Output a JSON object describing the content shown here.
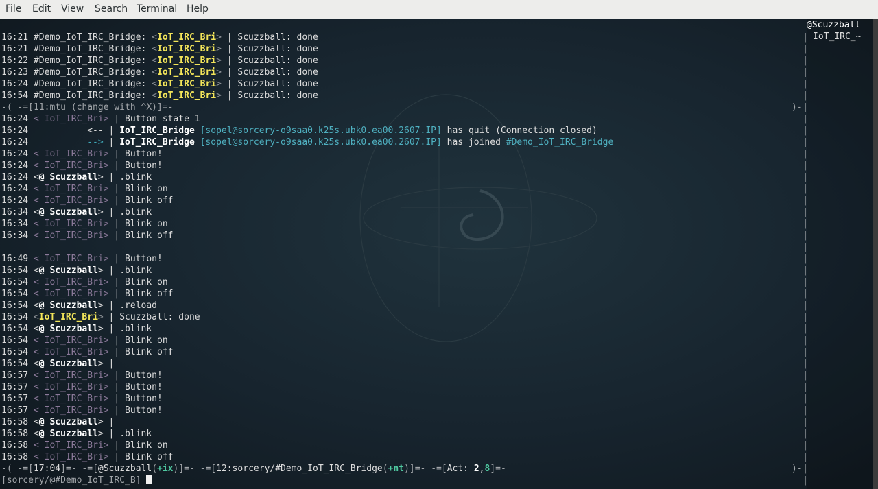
{
  "menubar": {
    "items": [
      "File",
      "Edit",
      "View",
      "Search",
      "Terminal",
      "Help"
    ]
  },
  "chat": {
    "top_lines": [
      {
        "time": "16:21",
        "chan": "#Demo_IoT_IRC_Bridge:",
        "nick": "IoT_IRC_Bri",
        "msg": "Scuzzball: done"
      },
      {
        "time": "16:21",
        "chan": "#Demo_IoT_IRC_Bridge:",
        "nick": "IoT_IRC_Bri",
        "msg": "Scuzzball: done"
      },
      {
        "time": "16:22",
        "chan": "#Demo_IoT_IRC_Bridge:",
        "nick": "IoT_IRC_Bri",
        "msg": "Scuzzball: done"
      },
      {
        "time": "16:23",
        "chan": "#Demo_IoT_IRC_Bridge:",
        "nick": "IoT_IRC_Bri",
        "msg": "Scuzzball: done"
      },
      {
        "time": "16:24",
        "chan": "#Demo_IoT_IRC_Bridge:",
        "nick": "IoT_IRC_Bri",
        "msg": "Scuzzball: done"
      },
      {
        "time": "16:54",
        "chan": "#Demo_IoT_IRC_Bridge:",
        "nick": "IoT_IRC_Bri",
        "msg": "Scuzzball: done"
      }
    ],
    "window_bar": "-( -=[11:mtu (change with ^X)]=-",
    "window_bar_end": ")-",
    "quit_line": {
      "time": "16:24",
      "arrow": "<--",
      "nick": "IoT_IRC_Bridge",
      "host": "[sopel@sorcery-o9saa0.k25s.ubk0.ea00.2607.IP]",
      "text": "has quit",
      "reason": "(Connection closed)"
    },
    "join_line": {
      "time": "16:24",
      "arrow": "-->",
      "nick": "IoT_IRC_Bridge",
      "host": "[sopel@sorcery-o9saa0.k25s.ubk0.ea00.2607.IP]",
      "text": "has joined",
      "channel": "#Demo_IoT_IRC_Bridge"
    },
    "first_line": {
      "time": "16:24",
      "nick": "IoT_IRC_Bri",
      "msg": "Button state 1"
    },
    "lines_a": [
      {
        "time": "16:24",
        "kind": "bot",
        "nick": "IoT_IRC_Bri",
        "msg": "Button!"
      },
      {
        "time": "16:24",
        "kind": "bot",
        "nick": "IoT_IRC_Bri",
        "msg": "Button!"
      },
      {
        "time": "16:24",
        "kind": "op",
        "nick": "Scuzzball",
        "msg": ".blink"
      },
      {
        "time": "16:24",
        "kind": "bot",
        "nick": "IoT_IRC_Bri",
        "msg": "Blink on"
      },
      {
        "time": "16:24",
        "kind": "bot",
        "nick": "IoT_IRC_Bri",
        "msg": "Blink off"
      },
      {
        "time": "16:34",
        "kind": "op",
        "nick": "Scuzzball",
        "msg": ".blink"
      },
      {
        "time": "16:34",
        "kind": "bot",
        "nick": "IoT_IRC_Bri",
        "msg": "Blink on"
      },
      {
        "time": "16:34",
        "kind": "bot",
        "nick": "IoT_IRC_Bri",
        "msg": "Blink off"
      }
    ],
    "lines_b": [
      {
        "time": "16:49",
        "kind": "bot",
        "nick": "IoT_IRC_Bri",
        "msg": "Button!"
      },
      {
        "time": "16:54",
        "kind": "op",
        "nick": "Scuzzball",
        "msg": ".blink"
      },
      {
        "time": "16:54",
        "kind": "bot",
        "nick": "IoT_IRC_Bri",
        "msg": "Blink on"
      },
      {
        "time": "16:54",
        "kind": "bot",
        "nick": "IoT_IRC_Bri",
        "msg": "Blink off"
      },
      {
        "time": "16:54",
        "kind": "op",
        "nick": "Scuzzball",
        "msg": ".reload"
      },
      {
        "time": "16:54",
        "kind": "hl",
        "nick": "IoT_IRC_Bri",
        "msg": "Scuzzball: done"
      },
      {
        "time": "16:54",
        "kind": "op",
        "nick": "Scuzzball",
        "msg": ".blink"
      },
      {
        "time": "16:54",
        "kind": "bot",
        "nick": "IoT_IRC_Bri",
        "msg": "Blink on"
      },
      {
        "time": "16:54",
        "kind": "bot",
        "nick": "IoT_IRC_Bri",
        "msg": "Blink off"
      },
      {
        "time": "16:54",
        "kind": "op",
        "nick": "Scuzzball",
        "msg": ""
      },
      {
        "time": "16:57",
        "kind": "bot",
        "nick": "IoT_IRC_Bri",
        "msg": "Button!"
      },
      {
        "time": "16:57",
        "kind": "bot",
        "nick": "IoT_IRC_Bri",
        "msg": "Button!"
      },
      {
        "time": "16:57",
        "kind": "bot",
        "nick": "IoT_IRC_Bri",
        "msg": "Button!"
      },
      {
        "time": "16:57",
        "kind": "bot",
        "nick": "IoT_IRC_Bri",
        "msg": "Button!"
      },
      {
        "time": "16:58",
        "kind": "op",
        "nick": "Scuzzball",
        "msg": ""
      },
      {
        "time": "16:58",
        "kind": "op",
        "nick": "Scuzzball",
        "msg": ".blink"
      },
      {
        "time": "16:58",
        "kind": "bot",
        "nick": "IoT_IRC_Bri",
        "msg": "Blink on"
      },
      {
        "time": "16:58",
        "kind": "bot",
        "nick": "IoT_IRC_Bri",
        "msg": "Blink off"
      }
    ]
  },
  "statusbar": {
    "time": "17:04",
    "user_prefix": "@Scuzzball",
    "user_modes": "+ix",
    "window": "12:sorcery/#Demo_IoT_IRC_Bridge",
    "chan_modes": "+nt",
    "act_label": "Act:",
    "act_2": "2",
    "act_8": "8",
    "end": ")-"
  },
  "prompt": {
    "text": "[sorcery/@#Demo_IoT_IRC_B]"
  },
  "nicklist": {
    "nicks": [
      "@Scuzzball",
      "IoT_IRC_~"
    ]
  }
}
